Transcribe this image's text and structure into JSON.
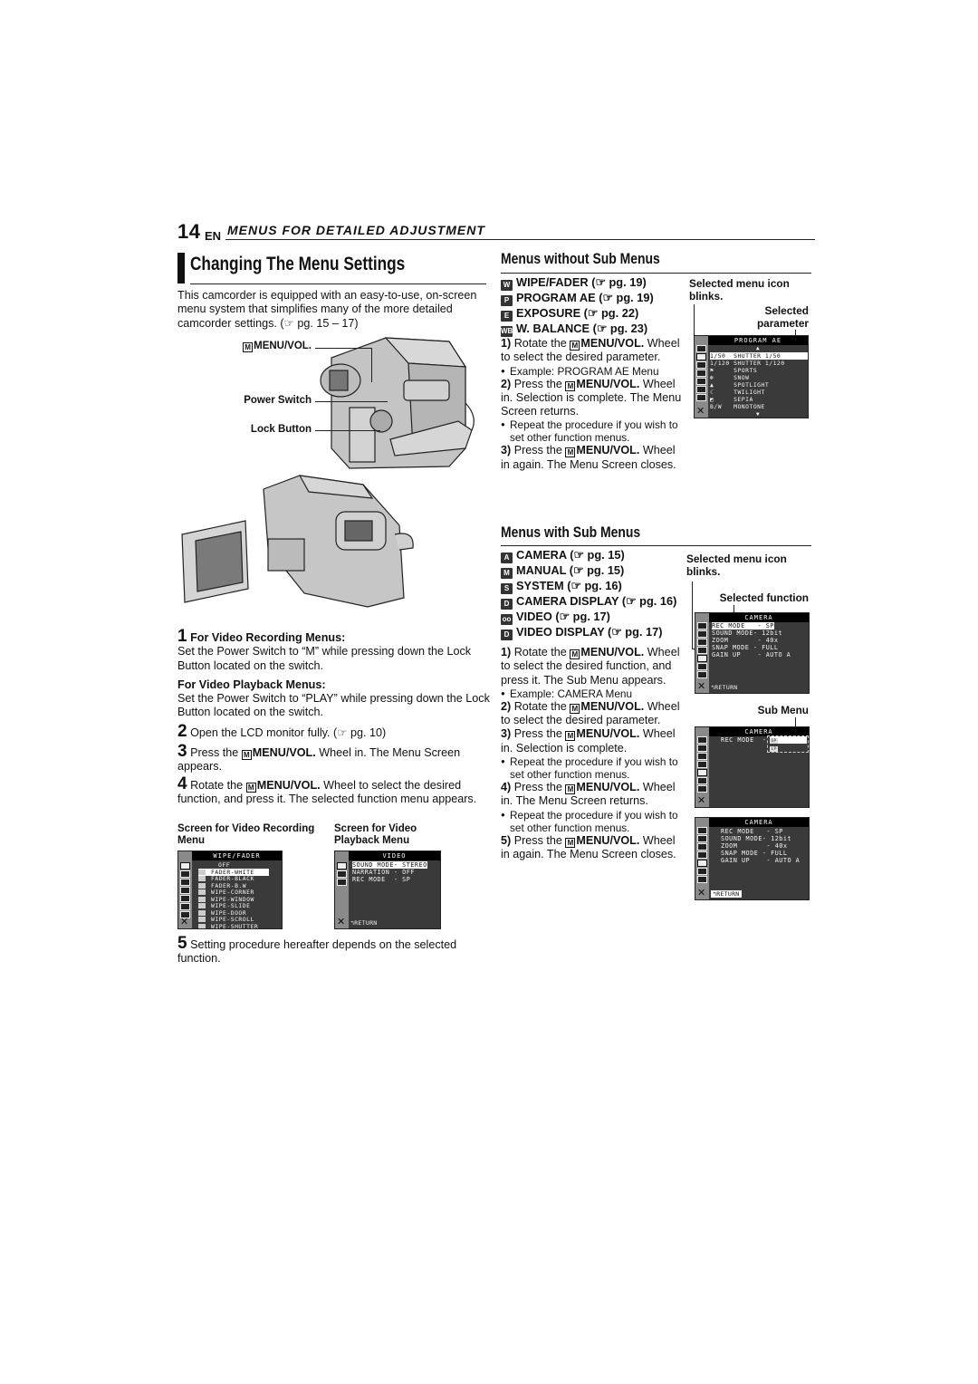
{
  "header": {
    "page_number": "14",
    "language": "EN",
    "section": "MENUS FOR DETAILED ADJUSTMENT"
  },
  "left": {
    "title": "Changing The Menu Settings",
    "intro": "This camcorder is equipped with an easy-to-use, on-screen menu system that simplifies many of the more detailed camcorder settings. (☞ pg. 15 – 17)",
    "callouts": {
      "menu_vol": "MENU/VOL.",
      "power_switch": "Power Switch",
      "lock_button": "Lock Button"
    },
    "steps": [
      {
        "num": "1",
        "heading": "For Video Recording Menus:",
        "text": "Set the Power Switch to “M” while pressing down the Lock Button located on the switch.",
        "sub_heading": "For Video Playback Menus:",
        "sub_text": "Set the Power Switch to “PLAY” while pressing down the Lock Button located on the switch."
      },
      {
        "num": "2",
        "text": "Open the LCD monitor fully. (☞ pg. 10)"
      },
      {
        "num": "3",
        "pre": "Press the ",
        "bold": "MENU/VOL.",
        "post": " Wheel in. The Menu Screen appears."
      },
      {
        "num": "4",
        "pre": "Rotate the ",
        "bold": "MENU/VOL.",
        "post": " Wheel to select the desired function, and press it. The selected function menu appears."
      },
      {
        "num": "5",
        "text": "Setting procedure hereafter depends on the selected function."
      }
    ],
    "screens": {
      "recording_caption": "Screen for Video Recording Menu",
      "playback_caption": "Screen for Video Playback Menu",
      "recording": {
        "title": "WIPE/FADER",
        "items": [
          "OFF",
          "FADER-WHITE",
          "FADER-BLACK",
          "FADER-B.W",
          "WIPE-CORNER",
          "WIPE-WINDOW",
          "WIPE-SLIDE",
          "WIPE-DOOR",
          "WIPE-SCROLL",
          "WIPE-SHUTTER"
        ],
        "selected": "FADER-WHITE"
      },
      "playback": {
        "title": "VIDEO",
        "rows": [
          "SOUND MODE- STEREO",
          "NARRATION - OFF",
          "REC MODE  - SP"
        ],
        "return": "RETURN"
      }
    }
  },
  "right": {
    "without_sub": {
      "heading": "Menus without Sub Menus",
      "items": [
        {
          "icon": "wipe-fader",
          "glyph": "W",
          "label": "WIPE/FADER",
          "ref": "(☞ pg. 19)"
        },
        {
          "icon": "program-ae",
          "glyph": "P",
          "label": "PROGRAM AE",
          "ref": "(☞ pg. 19)"
        },
        {
          "icon": "exposure",
          "glyph": "E",
          "label": "EXPOSURE",
          "ref": "(☞ pg. 22)"
        },
        {
          "icon": "white-balance",
          "glyph": "WB",
          "label": "W. BALANCE",
          "ref": "(☞ pg. 23)"
        }
      ],
      "steps": [
        {
          "num": "1)",
          "pre": "Rotate the ",
          "bold": "MENU/VOL.",
          "post": " Wheel to select the desired parameter."
        },
        {
          "bullet": "Example: PROGRAM AE Menu"
        },
        {
          "num": "2)",
          "pre": "Press the ",
          "bold": "MENU/VOL.",
          "post": " Wheel in. Selection is complete. The Menu Screen returns."
        },
        {
          "bullet": "Repeat the procedure if you wish to set other function menus."
        },
        {
          "num": "3)",
          "pre": "Press the ",
          "bold": "MENU/VOL.",
          "post": " Wheel in again. The Menu Screen closes."
        }
      ],
      "annot_icon": "Selected menu icon blinks.",
      "annot_param": "Selected parameter",
      "screen": {
        "title": "PROGRAM AE",
        "rows": [
          {
            "ic": "1/50",
            "label": "SHUTTER 1/50",
            "selected": true
          },
          {
            "ic": "1/120",
            "label": "SHUTTER 1/120",
            "selected": false
          },
          {
            "ic": "⚑",
            "label": "SPORTS",
            "selected": false
          },
          {
            "ic": "❄",
            "label": "SNOW",
            "selected": false
          },
          {
            "ic": "▲",
            "label": "SPOTLIGHT",
            "selected": false
          },
          {
            "ic": "☾",
            "label": "TWILIGHT",
            "selected": false
          },
          {
            "ic": "◩",
            "label": "SEPIA",
            "selected": false
          },
          {
            "ic": "B/W",
            "label": "MONOTONE",
            "selected": false
          }
        ]
      }
    },
    "with_sub": {
      "heading": "Menus with Sub Menus",
      "items": [
        {
          "icon": "camera",
          "glyph": "A",
          "label": "CAMERA",
          "ref": "(☞ pg. 15)"
        },
        {
          "icon": "manual",
          "glyph": "M",
          "label": "MANUAL",
          "ref": "(☞ pg. 15)"
        },
        {
          "icon": "system",
          "glyph": "S",
          "label": "SYSTEM",
          "ref": "(☞ pg. 16)"
        },
        {
          "icon": "camera-display",
          "glyph": "D",
          "label": "CAMERA DISPLAY",
          "ref": "(☞ pg. 16)"
        },
        {
          "icon": "video",
          "glyph": "oo",
          "label": "VIDEO",
          "ref": "(☞ pg. 17)"
        },
        {
          "icon": "video-display",
          "glyph": "D",
          "label": "VIDEO DISPLAY",
          "ref": "(☞ pg. 17)"
        }
      ],
      "steps": [
        {
          "num": "1)",
          "pre": "Rotate the ",
          "bold": "MENU/VOL.",
          "post": " Wheel to select the desired function, and press it. The Sub Menu appears."
        },
        {
          "bullet": "Example: CAMERA Menu"
        },
        {
          "num": "2)",
          "pre": "Rotate the ",
          "bold": "MENU/VOL.",
          "post": " Wheel to select the desired parameter."
        },
        {
          "num": "3)",
          "pre": "Press the ",
          "bold": "MENU/VOL.",
          "post": " Wheel in. Selection is complete."
        },
        {
          "bullet": "Repeat the procedure if you wish to set other function menus."
        },
        {
          "num": "4)",
          "pre": "Press the ",
          "bold": "MENU/VOL.",
          "post": " Wheel in. The Menu Screen returns."
        },
        {
          "bullet": "Repeat the procedure if you wish to set other function menus."
        },
        {
          "num": "5)",
          "pre": "Press the ",
          "bold": "MENU/VOL.",
          "post": " Wheel in again. The Menu Screen closes."
        }
      ],
      "annot_icon": "Selected menu icon blinks.",
      "annot_function": "Selected function",
      "annot_submenu": "Sub Menu",
      "camera_screen": {
        "title": "CAMERA",
        "rows": [
          "REC MODE   - SP",
          "SOUND MODE- 12bit",
          "ZOOM       - 40x",
          "SNAP MODE - FULL",
          "GAIN UP    - AUTO A"
        ],
        "return": "RETURN"
      },
      "sub_screen": {
        "title": "CAMERA",
        "row": "REC MODE  -",
        "options": [
          "SP",
          "LP"
        ]
      },
      "return_screen": {
        "title": "CAMERA",
        "rows": [
          "REC MODE   - SP",
          "SOUND MODE- 12bit",
          "ZOOM       - 40x",
          "SNAP MODE - FULL",
          "GAIN UP    - AUTO A"
        ],
        "return": "RETURN"
      }
    }
  },
  "m_icon": "M"
}
